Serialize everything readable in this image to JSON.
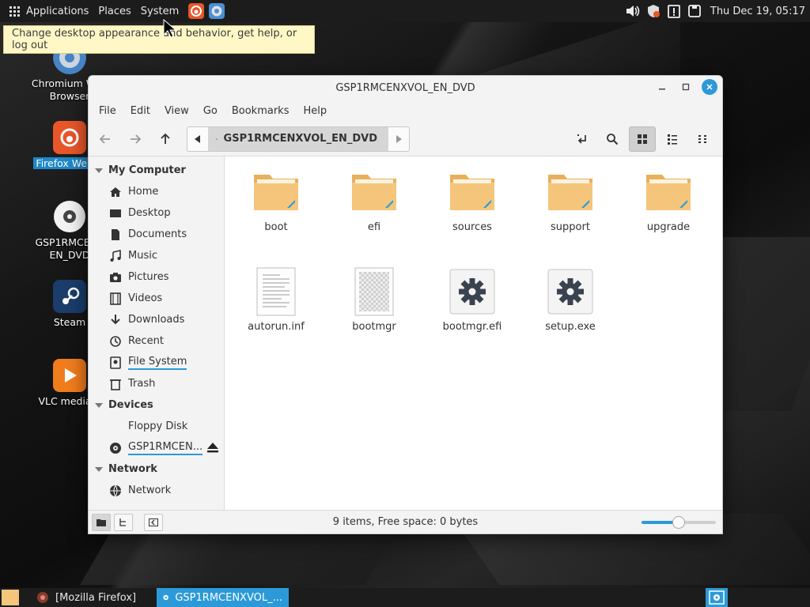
{
  "top_panel": {
    "menus": [
      "Applications",
      "Places",
      "System"
    ],
    "clock": "Thu Dec 19, 05:17"
  },
  "tooltip": "Change desktop appearance and behavior, get help, or log out",
  "desktop_icons": [
    {
      "label": "Chromium Web Browser",
      "icon": "chromium-icon"
    },
    {
      "label": "Firefox Web B",
      "icon": "firefox-icon"
    },
    {
      "label": "GSP1RMCENX EN_DVD",
      "icon": "disc-icon"
    },
    {
      "label": "Steam",
      "icon": "steam-icon"
    },
    {
      "label": "VLC media p",
      "icon": "vlc-icon"
    }
  ],
  "window": {
    "title": "GSP1RMCENXVOL_EN_DVD",
    "menubar": [
      "File",
      "Edit",
      "View",
      "Go",
      "Bookmarks",
      "Help"
    ],
    "path": "GSP1RMCENXVOL_EN_DVD",
    "sidebar": {
      "my_computer_header": "My Computer",
      "my_computer": [
        "Home",
        "Desktop",
        "Documents",
        "Music",
        "Pictures",
        "Videos",
        "Downloads",
        "Recent",
        "File System",
        "Trash"
      ],
      "devices_header": "Devices",
      "devices": [
        "Floppy Disk",
        "GSP1RMCEN..."
      ],
      "network_header": "Network",
      "network": [
        "Network"
      ]
    },
    "files": [
      {
        "name": "boot",
        "type": "folder"
      },
      {
        "name": "efi",
        "type": "folder"
      },
      {
        "name": "sources",
        "type": "folder"
      },
      {
        "name": "support",
        "type": "folder"
      },
      {
        "name": "upgrade",
        "type": "folder"
      },
      {
        "name": "autorun.inf",
        "type": "text"
      },
      {
        "name": "bootmgr",
        "type": "binary"
      },
      {
        "name": "bootmgr.efi",
        "type": "executable"
      },
      {
        "name": "setup.exe",
        "type": "executable"
      }
    ],
    "status": "9 items, Free space: 0 bytes",
    "zoom_level": 0.5
  },
  "taskbar": {
    "tasks": [
      "[Mozilla Firefox]",
      "GSP1RMCENXVOL_..."
    ]
  },
  "colors": {
    "accent": "#2c9ad8",
    "folder": "#f4c57a",
    "panel": "#1c1c1c",
    "tooltip_bg": "#fff8c6"
  }
}
